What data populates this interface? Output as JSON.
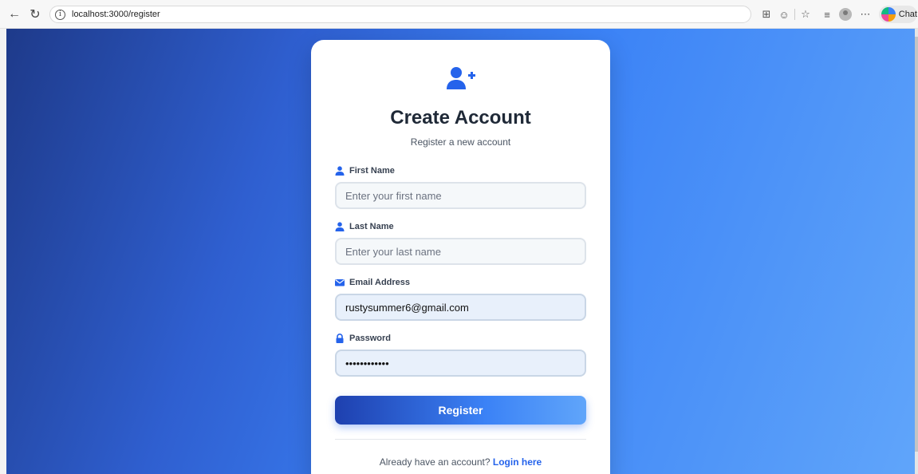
{
  "browser": {
    "url": "localhost:3000/register",
    "chat_label": "Chat",
    "icons": [
      "back-icon",
      "refresh-icon",
      "info-icon",
      "split-screen-icon",
      "emoji-icon",
      "favorite-star-icon",
      "favorites-icon",
      "profile-avatar",
      "more-icon",
      "copilot-icon"
    ]
  },
  "form": {
    "icon": "user-plus-icon",
    "title": "Create Account",
    "subtitle": "Register a new account",
    "fields": {
      "first_name": {
        "label": "First Name",
        "placeholder": "Enter your first name",
        "value": "",
        "icon": "user-icon"
      },
      "last_name": {
        "label": "Last Name",
        "placeholder": "Enter your last name",
        "value": "",
        "icon": "user-icon"
      },
      "email": {
        "label": "Email Address",
        "placeholder": "",
        "value": "rustysummer6@gmail.com",
        "icon": "envelope-icon"
      },
      "password": {
        "label": "Password",
        "placeholder": "",
        "value": "rustysummer6",
        "icon": "lock-icon"
      }
    },
    "submit_label": "Register",
    "footer_prompt": "Already have an account?",
    "footer_link": "Login here"
  },
  "colors": {
    "accent": "#2563eb",
    "gradient_start": "#1e3a8a",
    "gradient_end": "#60a5fa"
  }
}
